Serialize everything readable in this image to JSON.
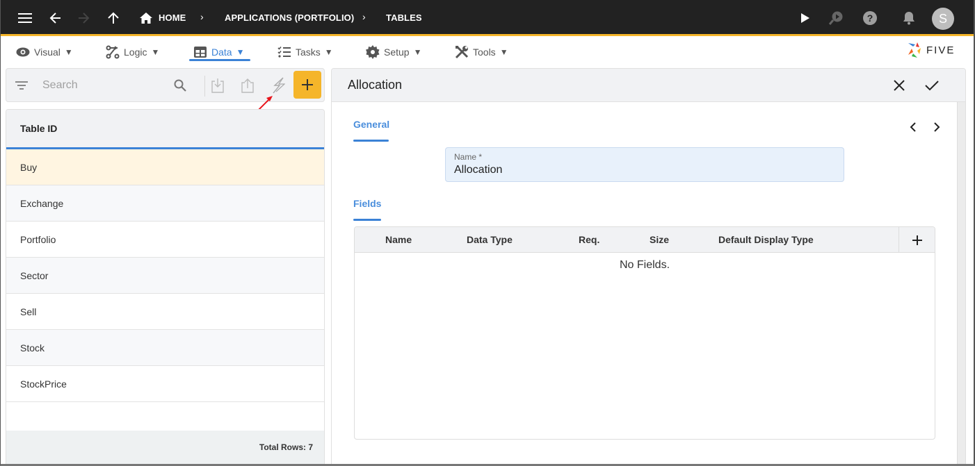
{
  "topbar": {
    "breadcrumbs": [
      {
        "label": "HOME"
      },
      {
        "label": "APPLICATIONS (PORTFOLIO)"
      },
      {
        "label": "TABLES"
      }
    ],
    "avatar_initial": "S",
    "icons": [
      "menu-icon",
      "back-arrow-icon",
      "forward-arrow-icon",
      "up-arrow-icon",
      "home-icon",
      "play-icon",
      "debug-play-icon",
      "help-icon",
      "bell-icon"
    ]
  },
  "menubar": {
    "items": [
      {
        "label": "Visual",
        "icon": "eye-icon"
      },
      {
        "label": "Logic",
        "icon": "logic-icon"
      },
      {
        "label": "Data",
        "icon": "table-grid-icon",
        "active": true
      },
      {
        "label": "Tasks",
        "icon": "tasks-list-icon"
      },
      {
        "label": "Setup",
        "icon": "gear-icon"
      },
      {
        "label": "Tools",
        "icon": "tools-icon"
      }
    ],
    "dropdown_glyph": "▼",
    "logo_text": "FIVE"
  },
  "left_panel": {
    "search": {
      "placeholder": "Search",
      "value": ""
    },
    "list": {
      "column_header": "Table ID",
      "rows": [
        "Buy",
        "Exchange",
        "Portfolio",
        "Sector",
        "Sell",
        "Stock",
        "StockPrice"
      ],
      "selected_index": 0,
      "footer": "Total Rows: 7"
    }
  },
  "form": {
    "title": "Allocation",
    "tabs": {
      "general": "General",
      "fields": "Fields"
    },
    "name_field": {
      "label": "Name *",
      "value": "Allocation"
    },
    "fields_table": {
      "columns": [
        "Name",
        "Data Type",
        "Req.",
        "Size",
        "Default Display Type"
      ],
      "empty_message": "No Fields."
    }
  },
  "colors": {
    "accent": "#f5b52a",
    "active_blue": "#3b82d6",
    "topbar_bg": "#222222",
    "selected_row": "#fff5e1"
  }
}
